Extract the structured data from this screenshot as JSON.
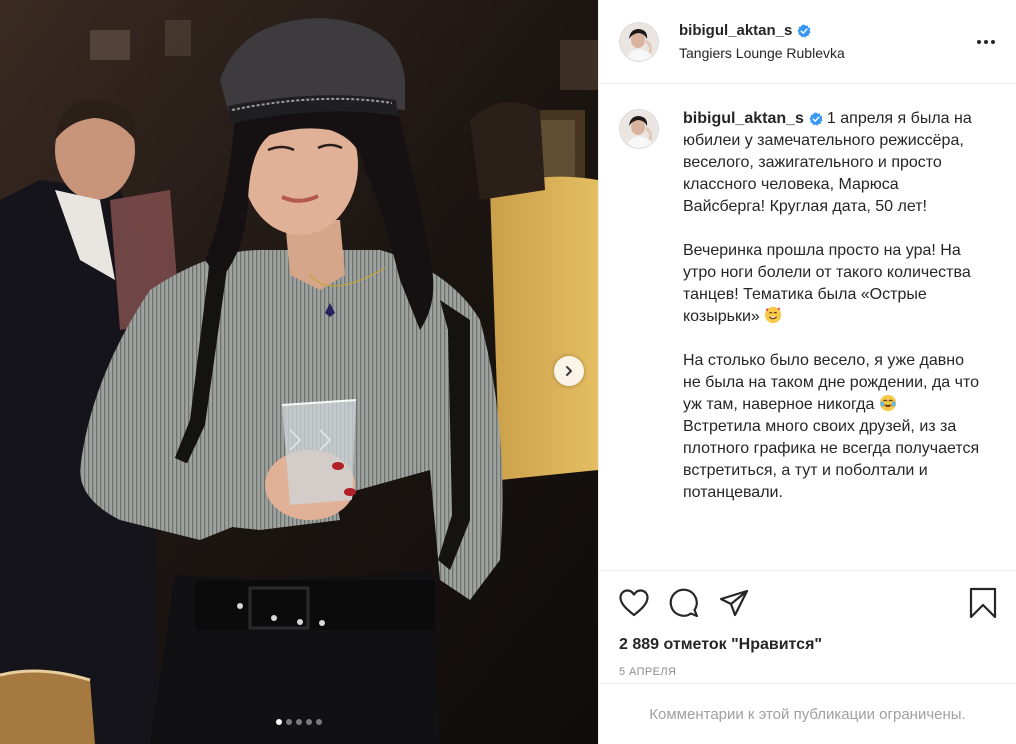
{
  "post": {
    "username": "bibigul_aktan_s",
    "verified": true,
    "location": "Tangiers Lounge Rublevka",
    "caption_lines": [
      "1 апреля я была на юбилеи у замечательного режиссёра, веселого, зажигательного и просто классного человека, Марюса Вайсберга! Круглая дата, 50 лет!",
      "Вечеринка прошла просто на ура! На утро ноги болели от такого количества танцев! Тематика была «Острые козырьки»",
      "На столько было весело, я уже давно не была на таком дне рождении, да что уж там, наверное никогда",
      "Встретила много своих друзей, из за плотного графика не всегда получается встретиться, а тут и поболтали и потанцевали."
    ],
    "likes": "2 889 отметок \"Нравится\"",
    "date": "5 апреля",
    "comments_disabled": "Комментарии к этой публикации ограничены."
  },
  "carousel": {
    "total": 5,
    "active": 0
  },
  "icons": {
    "more": "more-options-icon",
    "like": "heart-icon",
    "comment": "comment-icon",
    "share": "share-icon",
    "save": "bookmark-icon",
    "next": "chevron-right-icon",
    "verified": "verified-badge-icon"
  },
  "colors": {
    "verified": "#3897f0",
    "muted": "#8e8e8e",
    "border": "#efefef"
  }
}
